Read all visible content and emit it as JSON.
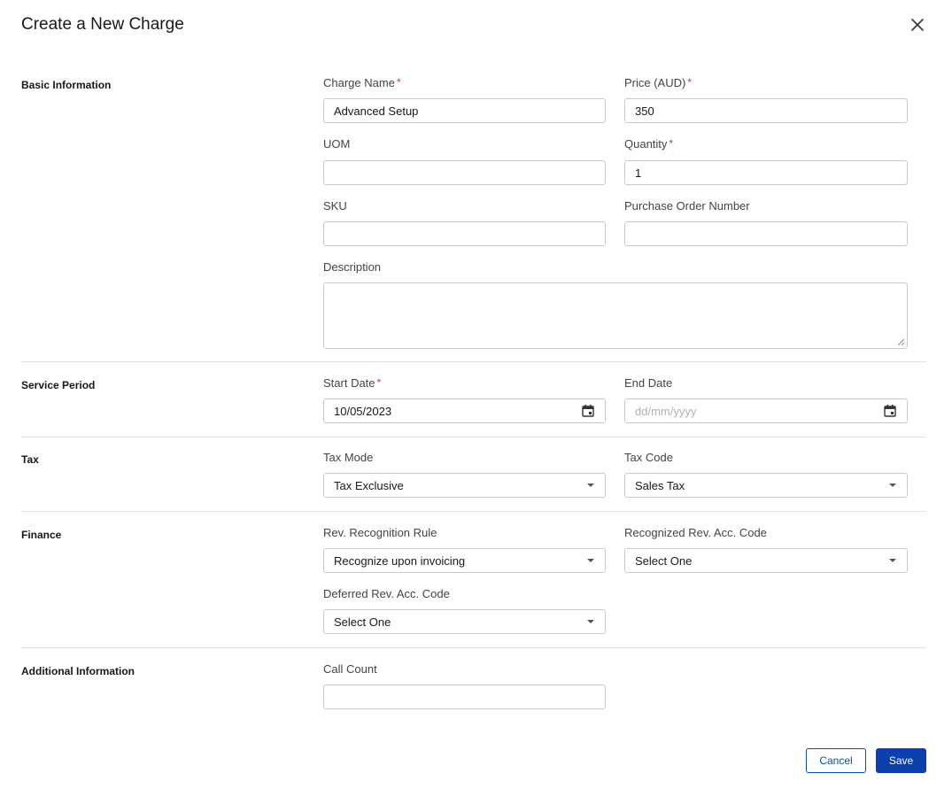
{
  "dialog": {
    "title": "Create a New Charge"
  },
  "sections": {
    "basic": "Basic Information",
    "service": "Service Period",
    "tax": "Tax",
    "finance": "Finance",
    "additional": "Additional Information"
  },
  "fields": {
    "charge_name": {
      "label": "Charge Name",
      "value": "Advanced Setup",
      "required": "*"
    },
    "price": {
      "label": "Price (AUD)",
      "value": "350",
      "required": "*"
    },
    "uom": {
      "label": "UOM",
      "value": ""
    },
    "quantity": {
      "label": "Quantity",
      "value": "1",
      "required": "*"
    },
    "sku": {
      "label": "SKU",
      "value": ""
    },
    "po_number": {
      "label": "Purchase Order Number",
      "value": ""
    },
    "description": {
      "label": "Description",
      "value": ""
    },
    "start_date": {
      "label": "Start Date",
      "value": "10/05/2023",
      "required": "*"
    },
    "end_date": {
      "label": "End Date",
      "placeholder": "dd/mm/yyyy"
    },
    "tax_mode": {
      "label": "Tax Mode",
      "value": "Tax Exclusive"
    },
    "tax_code": {
      "label": "Tax Code",
      "value": "Sales Tax"
    },
    "rev_rule": {
      "label": "Rev. Recognition Rule",
      "value": "Recognize upon invoicing"
    },
    "recognized_code": {
      "label": "Recognized Rev. Acc. Code",
      "value": "Select One"
    },
    "deferred_code": {
      "label": "Deferred Rev. Acc. Code",
      "value": "Select One"
    },
    "call_count": {
      "label": "Call Count",
      "value": ""
    }
  },
  "buttons": {
    "cancel": "Cancel",
    "save": "Save"
  },
  "colors": {
    "primary": "#0b3fae",
    "required": "#c23934",
    "border": "#c9c9c9"
  }
}
